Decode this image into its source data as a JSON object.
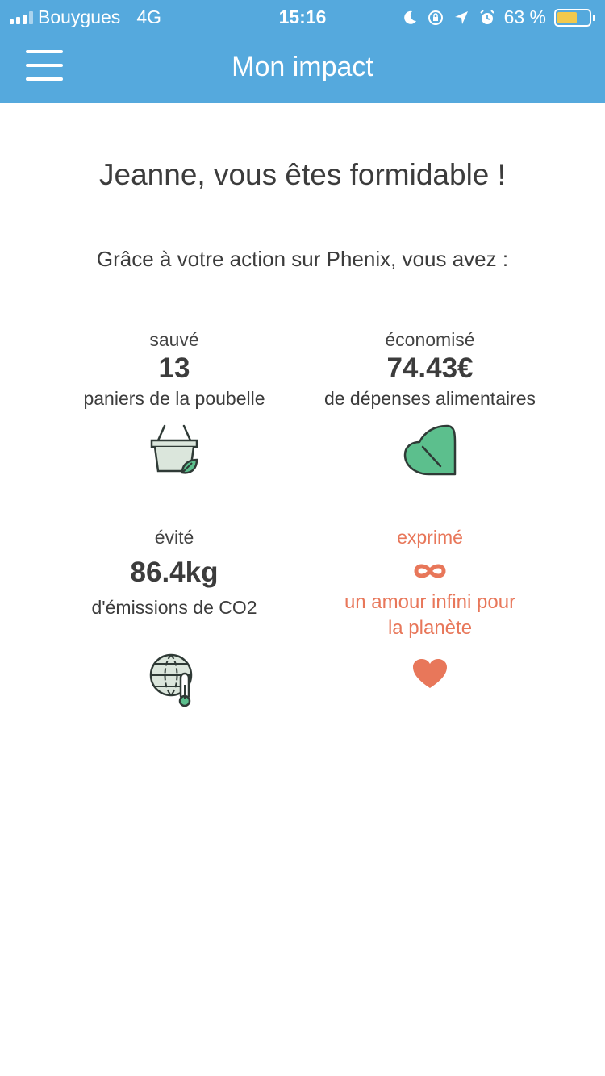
{
  "status_bar": {
    "carrier": "Bouygues",
    "network": "4G",
    "time": "15:16",
    "battery_percent": "63 %",
    "battery_level": 0.63
  },
  "header": {
    "title": "Mon impact",
    "background_color": "#55a9dd"
  },
  "main": {
    "greeting": "Jeanne, vous êtes formidable !",
    "intro": "Grâce à votre action sur Phenix, vous avez :",
    "stats": [
      {
        "verb": "sauvé",
        "value": "13",
        "description": "paniers de la poubelle",
        "icon": "basket-leaf-icon"
      },
      {
        "verb": "économisé",
        "value": "74.43€",
        "description": "de dépenses alimentaires",
        "icon": "leaf-icon"
      },
      {
        "verb": "évité",
        "value": "86.4kg",
        "description": "d'émissions de CO2",
        "icon": "globe-thermometer-icon"
      },
      {
        "verb": "exprimé",
        "value": "∞",
        "description_line1": "un amour infini pour",
        "description_line2": "la planète",
        "icon": "heart-icon",
        "accent_color": "#e8775a"
      }
    ]
  }
}
